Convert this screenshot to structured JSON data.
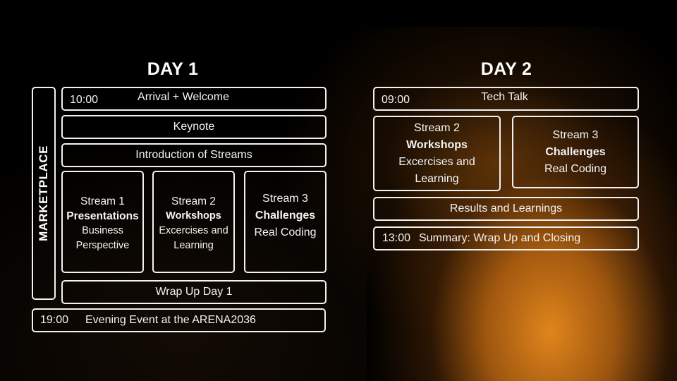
{
  "day1": {
    "title": "DAY 1",
    "marketplace_label": "MARKETPLACE",
    "arrival": {
      "time": "10:00",
      "label": "Arrival + Welcome"
    },
    "keynote": {
      "label": "Keynote"
    },
    "introduction": {
      "label": "Introduction of Streams"
    },
    "streams": [
      {
        "name": "Stream 1",
        "type": "Presentations",
        "desc1": "Business",
        "desc2": "Perspective"
      },
      {
        "name": "Stream 2",
        "type": "Workshops",
        "desc1": "Excercises and",
        "desc2": "Learning"
      },
      {
        "name": "Stream 3",
        "type": "Challenges",
        "desc1": "Real Coding",
        "desc2": ""
      }
    ],
    "wrapup": {
      "label": "Wrap Up Day 1"
    },
    "evening": {
      "time": "19:00",
      "label": "Evening Event at the ARENA2036"
    }
  },
  "day2": {
    "title": "DAY 2",
    "techtalk": {
      "time": "09:00",
      "label": "Tech Talk"
    },
    "streams": [
      {
        "name": "Stream 2",
        "type": "Workshops",
        "desc1": "Excercises and",
        "desc2": "Learning"
      },
      {
        "name": "Stream 3",
        "type": "Challenges",
        "desc1": "Real Coding",
        "desc2": ""
      }
    ],
    "results": {
      "label": "Results and Learnings"
    },
    "summary": {
      "time": "13:00",
      "label": "Summary: Wrap Up and Closing"
    }
  },
  "colors": {
    "background": "#000000",
    "accent_glow": "#EC8C1E",
    "border": "#F2F2F2",
    "text": "#FFFFFF"
  }
}
